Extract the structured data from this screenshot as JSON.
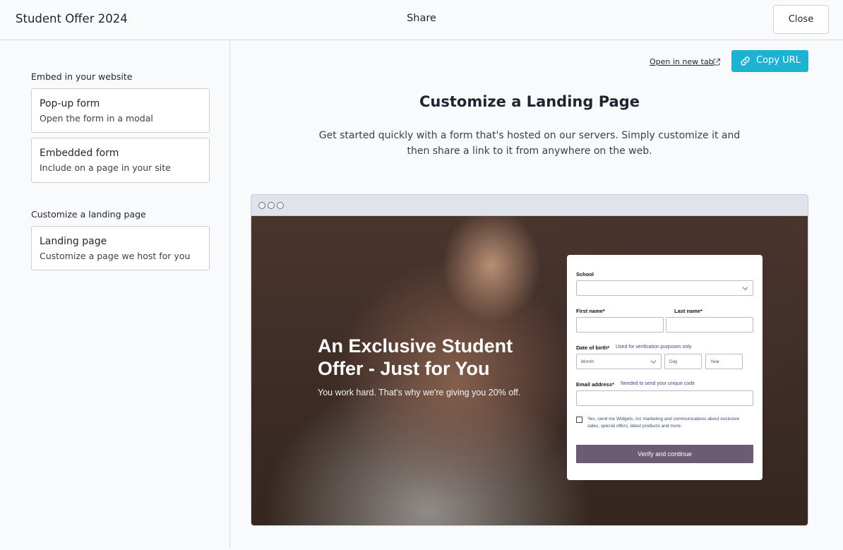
{
  "header": {
    "app_title": "Student Offer 2024",
    "center_title": "Share",
    "close_label": "Close"
  },
  "sidebar": {
    "embed_heading": "Embed in your website",
    "embed_options": [
      {
        "title": "Pop-up form",
        "description": "Open the form in a modal"
      },
      {
        "title": "Embedded form",
        "description": "Include on a page in your site"
      }
    ],
    "landing_heading": "Customize a landing page",
    "landing_options": [
      {
        "title": "Landing page",
        "description": "Customize a page we host for you"
      }
    ]
  },
  "main": {
    "open_new_tab": "Open in new tab",
    "copy_url": "Copy URL",
    "title": "Customize a Landing Page",
    "description": "Get started quickly with a form that's hosted on our servers. Simply customize it and then share a link to it from anywhere on the web."
  },
  "preview": {
    "hero_title": "An Exclusive Student Offer - Just for You",
    "hero_subtitle": "You work hard. That's why we're giving you 20% off.",
    "form": {
      "school_label": "School",
      "first_name_label": "First name*",
      "last_name_label": "Last name*",
      "dob_label": "Date of birth*",
      "dob_hint": "Used for verification purposes only",
      "month_placeholder": "Month",
      "day_placeholder": "Day",
      "year_placeholder": "Year",
      "email_label": "Email address*",
      "email_hint": "Needed to send your unique code",
      "consent_text": "Yes, send me Widgets, Inc marketing and communications about exclusive sales, special offers, latest products and more.",
      "submit_label": "Verify and continue"
    }
  },
  "colors": {
    "accent": "#1bb3d1",
    "submit_button": "#6b5b73"
  }
}
